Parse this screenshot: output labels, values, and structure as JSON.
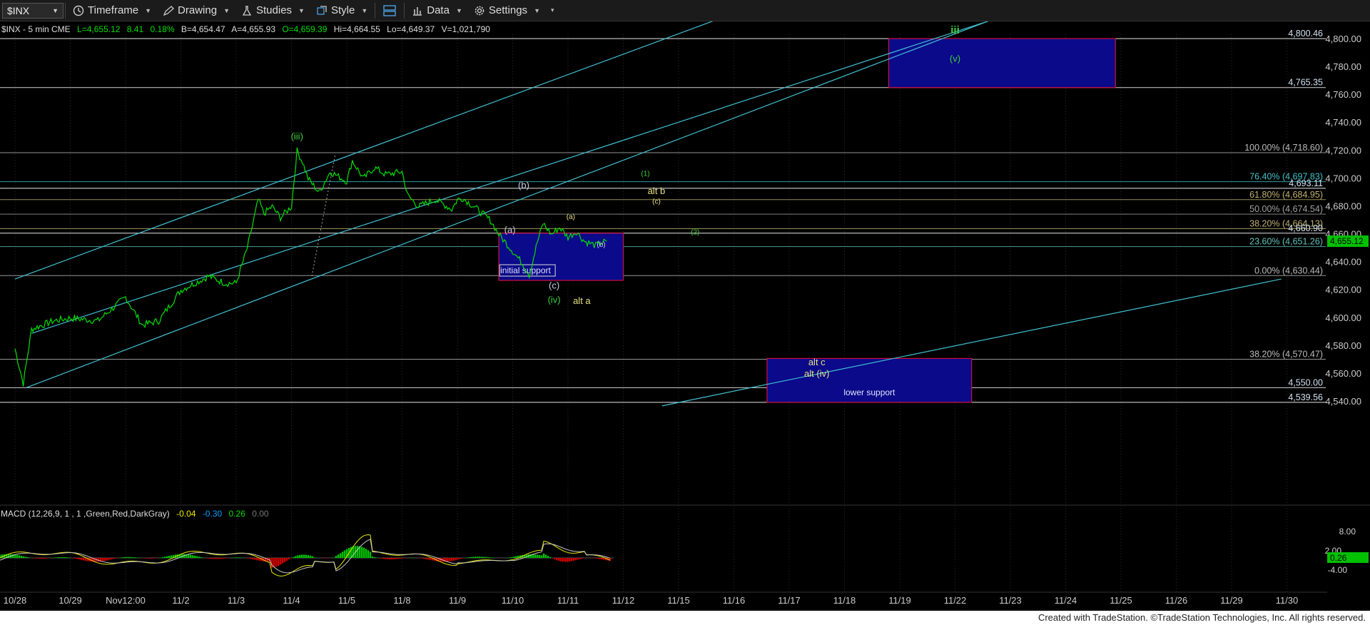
{
  "toolbar": {
    "symbol": "$INX",
    "timeframe": "Timeframe",
    "drawing": "Drawing",
    "studies": "Studies",
    "style": "Style",
    "data": "Data",
    "settings": "Settings"
  },
  "header": {
    "symbol_info": "$INX - 5 min  CME",
    "last": "L=4,655.12",
    "change": "8.41",
    "change_pct": "0.18%",
    "bid": "B=4,654.47",
    "ask": "A=4,655.93",
    "open": "O=4,659.39",
    "high": "Hi=4,664.55",
    "low": "Lo=4,649.37",
    "volume": "V=1,021,790"
  },
  "macd": {
    "label": "MACD (12,26,9, 1 , 1 ,Green,Red,DarkGray)",
    "v1": "-0.04",
    "v2": "-0.30",
    "v3": "0.26",
    "v4": "0.00",
    "axis": [
      "8.00",
      "2.00",
      "-4.00"
    ],
    "last_tag": "0.26"
  },
  "footer": "Created with TradeStation. ©TradeStation Technologies, Inc. All rights reserved.",
  "colors": {
    "price": "#00e000",
    "channel": "#40c0d0",
    "fib": "#aaaaaa",
    "box_fill": "#0a0a8a",
    "box_border": "#d01040",
    "wave_green": "#40d040",
    "wave_yellow": "#e8e080",
    "wave_white": "#c8c8e8"
  },
  "chart_data": {
    "type": "line",
    "title": "$INX - 5 min",
    "x_tick_labels": [
      "10/28",
      "10/29",
      "Nov12:00",
      "11/2",
      "11/3",
      "11/4",
      "11/5",
      "11/8",
      "11/9",
      "11/10",
      "11/11",
      "11/12",
      "11/15",
      "11/16",
      "11/17",
      "11/18",
      "11/19",
      "11/22",
      "11/23",
      "11/24",
      "11/25",
      "11/26",
      "11/29",
      "11/30"
    ],
    "y_tick_labels": [
      "4,800.00",
      "4,780.00",
      "4,760.00",
      "4,740.00",
      "4,720.00",
      "4,700.00",
      "4,680.00",
      "4,660.00",
      "4,640.00",
      "4,620.00",
      "4,600.00",
      "4,580.00",
      "4,560.00",
      "4,540.00"
    ],
    "ylim": [
      4533,
      4813
    ],
    "last_price_tag": "4,655.12",
    "price_series": {
      "x_index": [
        0,
        0.15,
        0.3,
        0.5,
        0.7,
        1.0,
        1.5,
        2.0,
        2.3,
        2.6,
        3.0,
        3.5,
        3.8,
        4.0,
        4.2,
        4.4,
        4.5,
        4.65,
        4.8,
        5.0,
        5.1,
        5.2,
        5.3,
        5.5,
        5.7,
        6.0,
        6.1,
        6.3,
        6.5,
        6.7,
        7.0,
        7.1,
        7.3,
        7.6,
        7.9,
        8.0,
        8.1,
        8.3,
        8.6,
        8.75,
        9.0,
        9.2,
        9.3,
        9.45,
        9.55,
        9.7,
        9.85,
        10.0,
        10.15,
        10.3,
        10.5,
        10.6,
        10.7
      ],
      "values": [
        4578,
        4553,
        4592,
        4595,
        4598,
        4600,
        4598,
        4615,
        4595,
        4598,
        4620,
        4630,
        4625,
        4625,
        4650,
        4685,
        4675,
        4680,
        4672,
        4680,
        4720,
        4712,
        4700,
        4690,
        4705,
        4698,
        4713,
        4700,
        4708,
        4703,
        4705,
        4688,
        4680,
        4685,
        4678,
        4685,
        4686,
        4680,
        4670,
        4660,
        4648,
        4638,
        4631,
        4655,
        4668,
        4660,
        4665,
        4658,
        4662,
        4655,
        4652,
        4654,
        4655
      ]
    },
    "horizontal_levels": [
      {
        "label": "4,800.46",
        "value": 4800.46
      },
      {
        "label": "4,765.35",
        "value": 4765.35
      },
      {
        "label": "100.00% (4,718.60)",
        "value": 4718.6
      },
      {
        "label": "76.40% (4,697.83)",
        "value": 4697.83
      },
      {
        "label": "4,693.11",
        "value": 4693.11
      },
      {
        "label": "61.80% (4,684.95)",
        "value": 4684.95
      },
      {
        "label": "50.00% (4,674.54)",
        "value": 4674.54
      },
      {
        "label": "38.20% (4,664.13)",
        "value": 4664.13
      },
      {
        "label": "4,660.90",
        "value": 4660.9
      },
      {
        "label": "23.60% (4,651.26)",
        "value": 4651.26
      },
      {
        "label": "0.00% (4,630.44)",
        "value": 4630.44
      },
      {
        "label": "38.20% (4,570.47)",
        "value": 4570.47
      },
      {
        "label": "4,550.00",
        "value": 4550.0
      },
      {
        "label": "4,539.56",
        "value": 4539.56
      }
    ],
    "zones": [
      {
        "label": "",
        "x_range": [
          15.8,
          19.9
        ],
        "y_range": [
          4765.35,
          4800.46
        ]
      },
      {
        "label": "initial support",
        "x_range": [
          8.75,
          11.0
        ],
        "y_range": [
          4627,
          4660.9
        ]
      },
      {
        "label": "lower support",
        "x_range": [
          13.6,
          17.3
        ],
        "y_range": [
          4539.56,
          4571
        ]
      }
    ],
    "wave_labels": [
      {
        "text": "(iii)",
        "x": 5.1,
        "y": 4728,
        "color": "green"
      },
      {
        "text": "(b)",
        "x": 9.2,
        "y": 4693,
        "color": "white"
      },
      {
        "text": "(a)",
        "x": 8.95,
        "y": 4661,
        "color": "white"
      },
      {
        "text": "(c)",
        "x": 9.75,
        "y": 4621,
        "color": "white"
      },
      {
        "text": "(iv)",
        "x": 9.75,
        "y": 4611,
        "color": "green"
      },
      {
        "text": "alt a",
        "x": 10.25,
        "y": 4610,
        "color": "yellow"
      },
      {
        "text": "a",
        "x": 10.05,
        "y": 4671,
        "color": "yellow"
      },
      {
        "text": "b",
        "x": 10.6,
        "y": 4651,
        "color": "white"
      },
      {
        "text": "alt b",
        "x": 11.6,
        "y": 4689,
        "color": "yellow"
      },
      {
        "text": "c",
        "x": 11.6,
        "y": 4682,
        "color": "yellow"
      },
      {
        "text": "1",
        "x": 11.4,
        "y": 4702,
        "color": "green"
      },
      {
        "text": "2",
        "x": 12.3,
        "y": 4660,
        "color": "green"
      },
      {
        "text": "iii",
        "x": 17.0,
        "y": 4804,
        "color": "green"
      },
      {
        "text": "(v)",
        "x": 17.0,
        "y": 4784,
        "color": "green"
      },
      {
        "text": "alt c",
        "x": 14.5,
        "y": 4566,
        "color": "yellow"
      },
      {
        "text": "alt (iv)",
        "x": 14.5,
        "y": 4558,
        "color": "yellow"
      }
    ],
    "channel_lines": [
      {
        "x1": 0,
        "y1": 4628,
        "x2": 13.3,
        "y2": 4823
      },
      {
        "x1": 0.3,
        "y1": 4589,
        "x2": 17.6,
        "y2": 4813
      },
      {
        "x1": 0.2,
        "y1": 4550,
        "x2": 17.6,
        "y2": 4813
      },
      {
        "x1": 11.7,
        "y1": 4537,
        "x2": 22.9,
        "y2": 4628
      }
    ]
  }
}
